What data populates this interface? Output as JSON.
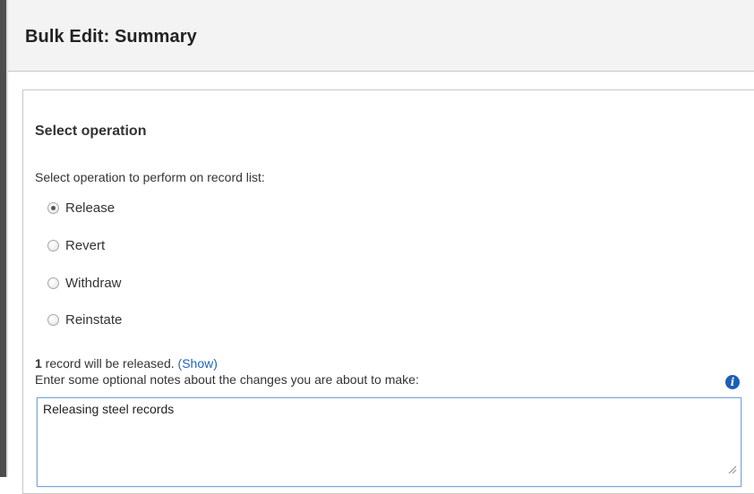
{
  "header": {
    "title": "Bulk Edit: Summary"
  },
  "operation": {
    "section_title": "Select operation",
    "instruction": "Select operation to perform on record list:",
    "options": [
      {
        "label": "Release",
        "checked": true
      },
      {
        "label": "Revert",
        "checked": false
      },
      {
        "label": "Withdraw",
        "checked": false
      },
      {
        "label": "Reinstate",
        "checked": false
      }
    ]
  },
  "summary": {
    "count": "1",
    "text": " record will be released. ",
    "show_link": "(Show)"
  },
  "notes": {
    "label": "Enter some optional notes about the changes you are about to make:",
    "value": "Releasing steel records",
    "info_icon": "info-icon"
  },
  "colors": {
    "link": "#1f63c2",
    "info_icon_bg": "#1b5fb5",
    "focus_border": "#7ea6d9"
  }
}
